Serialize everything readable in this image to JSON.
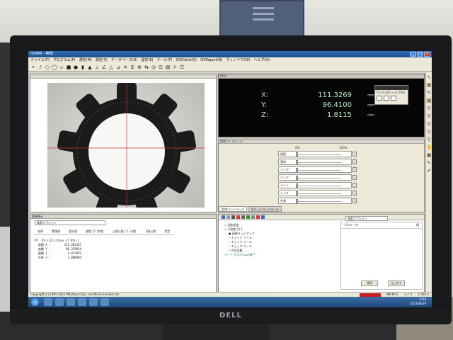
{
  "window": {
    "title": "QVPAK - 無題"
  },
  "menu": [
    "ファイル(F)",
    "プログラム(P)",
    "測定(M)",
    "測定(S)",
    "データベース(D)",
    "設定(E)",
    "ツール(T)",
    "QVClient(Q)",
    "QVReport(R)",
    "ウィンドウ(W)",
    "ヘルプ(H)"
  ],
  "readout": {
    "x_label": "X:",
    "x_value": "111.3269",
    "x_unit": "mm",
    "y_label": "Y:",
    "y_value": "96.4100",
    "y_unit": "mm",
    "z_label": "Z:",
    "z_value": "1.8115",
    "z_unit": "mm",
    "mini_menu": "ファイル(F) ヘルプ(H)"
  },
  "light": {
    "title": "照明コントロール",
    "scale_min": "0%",
    "scale_max": "100%",
    "rows": [
      "透過",
      "落射",
      "リング",
      "バック",
      "ライト",
      "レンズ",
      "外周"
    ],
    "tabs": [
      "照明コントロール",
      "ステージコントロール"
    ]
  },
  "results": {
    "title": "結果表示",
    "option": "検索オプション",
    "columns": [
      "名称",
      "実測値",
      "設計値",
      "誤差 (下 許差)",
      "上限公差 (下 公差)",
      "下限公差",
      "判定"
    ],
    "lines": [
      "PT  PT-1(2)1_Droo (7 Pts.)",
      "  座標 X :        111.381335",
      "  座標 Y :         96.379934",
      "  座標 Z :          1.817879",
      "  半径 3 :          1.808940"
    ]
  },
  "program": {
    "tree": [
      "○ 測定設定",
      "○ 円測定 円 1",
      "● 画像セットアップ",
      "─ チェック ツール",
      "─ チェック ツール",
      "─ チェック ツール",
      "─ 円の記載",
      "パートプログラムの終了"
    ],
    "param_header_left": "パラメータ",
    "param_header_right": "値",
    "param_option": "検索オプション",
    "btn_save": "適用",
    "btn_cancel": "元に戻す"
  },
  "status": {
    "copyright": "Copyright (c) 1995-2011 Mitutoyo Corp. and Micro Encoder Inc.",
    "mode": "MM  MCS",
    "live": "ライブ",
    "zoom": "1.000 X"
  },
  "clock": {
    "time": "9:34",
    "date": "2023/06/29"
  }
}
